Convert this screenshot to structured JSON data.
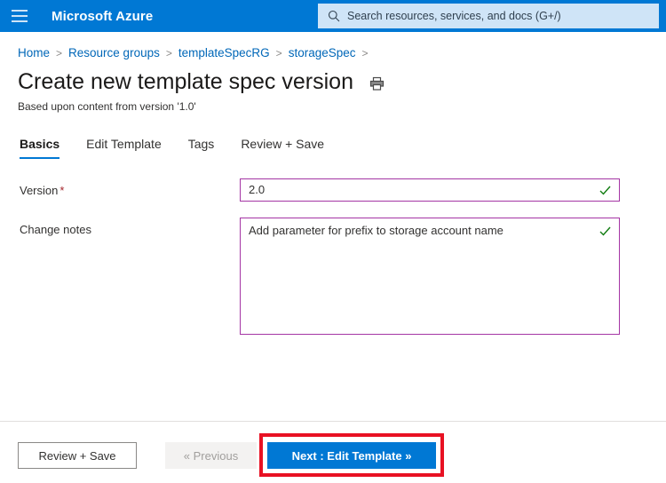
{
  "header": {
    "menu_icon": "hamburger-menu-icon",
    "brand": "Microsoft Azure",
    "search": {
      "icon": "search-icon",
      "placeholder": "Search resources, services, and docs (G+/)",
      "value": ""
    },
    "background_color": "#0078d4",
    "search_background_color": "#cfe4f7"
  },
  "breadcrumb": {
    "separator": ">",
    "items": [
      {
        "label": "Home"
      },
      {
        "label": "Resource groups"
      },
      {
        "label": "templateSpecRG"
      },
      {
        "label": "storageSpec"
      }
    ],
    "link_color": "#0067b8"
  },
  "page": {
    "title": "Create new template spec version",
    "print_icon": "printer-icon",
    "subtitle": "Based upon content from version '1.0'"
  },
  "tabs": {
    "active_index": 0,
    "accent_color": "#0078d4",
    "items": [
      {
        "label": "Basics"
      },
      {
        "label": "Edit Template"
      },
      {
        "label": "Tags"
      },
      {
        "label": "Review + Save"
      }
    ]
  },
  "form": {
    "border_color": "#a435a4",
    "valid_icon_color": "#107c10",
    "required_marker": "*",
    "fields": [
      {
        "label": "Version",
        "required": true,
        "value": "2.0",
        "placeholder": "",
        "valid": true
      },
      {
        "label": "Change notes",
        "required": false,
        "value": "Add parameter for prefix to storage account name",
        "placeholder": "",
        "valid": true
      }
    ]
  },
  "footer": {
    "review_save_label": "Review + Save",
    "previous_label": "« Previous",
    "next_label": "Next : Edit Template »",
    "primary_color": "#0078d4",
    "highlight_color": "#e81123",
    "disabled_color": "#a19f9d"
  }
}
